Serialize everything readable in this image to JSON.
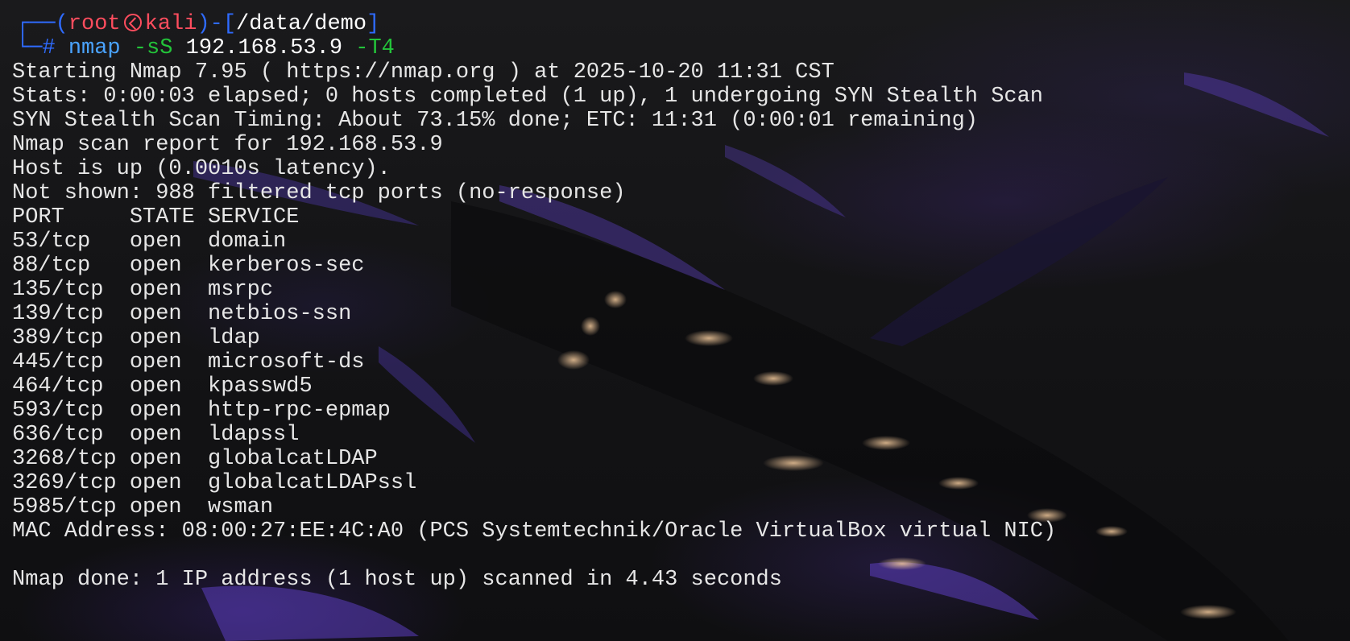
{
  "prompt": {
    "open_paren": "(",
    "user": "root",
    "host": "kali",
    "close_paren_dash": ")-",
    "open_bracket": "[",
    "path": "/data/demo",
    "close_bracket": "]",
    "hash": "#",
    "command": "nmap",
    "flag1": "-sS",
    "target": "192.168.53.9",
    "flag2": "-T4"
  },
  "output": [
    "Starting Nmap 7.95 ( https://nmap.org ) at 2025-10-20 11:31 CST",
    "Stats: 0:00:03 elapsed; 0 hosts completed (1 up), 1 undergoing SYN Stealth Scan",
    "SYN Stealth Scan Timing: About 73.15% done; ETC: 11:31 (0:00:01 remaining)",
    "Nmap scan report for 192.168.53.9",
    "Host is up (0.0010s latency).",
    "Not shown: 988 filtered tcp ports (no-response)",
    "PORT     STATE SERVICE",
    "53/tcp   open  domain",
    "88/tcp   open  kerberos-sec",
    "135/tcp  open  msrpc",
    "139/tcp  open  netbios-ssn",
    "389/tcp  open  ldap",
    "445/tcp  open  microsoft-ds",
    "464/tcp  open  kpasswd5",
    "593/tcp  open  http-rpc-epmap",
    "636/tcp  open  ldapssl",
    "3268/tcp open  globalcatLDAP",
    "3269/tcp open  globalcatLDAPssl",
    "5985/tcp open  wsman",
    "MAC Address: 08:00:27:EE:4C:A0 (PCS Systemtechnik/Oracle VirtualBox virtual NIC)",
    "",
    "Nmap done: 1 IP address (1 host up) scanned in 4.43 seconds"
  ],
  "colors": {
    "prompt_frame": "#2f6bff",
    "user_host": "#ff4d5e",
    "command": "#4aa3ff",
    "flags": "#23c43a",
    "text": "#e6e6e6"
  }
}
